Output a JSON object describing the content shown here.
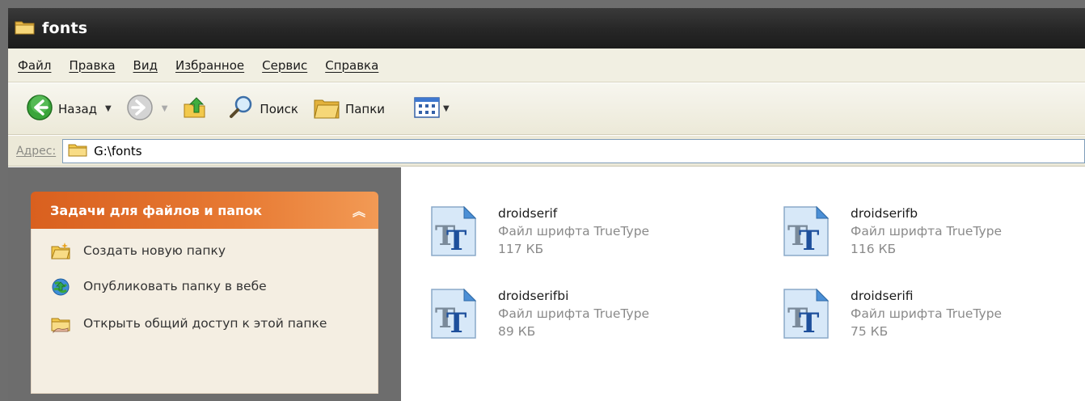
{
  "window": {
    "title": "fonts"
  },
  "menu": {
    "items": [
      "Файл",
      "Правка",
      "Вид",
      "Избранное",
      "Сервис",
      "Справка"
    ]
  },
  "toolbar": {
    "back_label": "Назад",
    "search_label": "Поиск",
    "folders_label": "Папки"
  },
  "address": {
    "label": "Адрес:",
    "value": "G:\\fonts"
  },
  "tasks": {
    "title": "Задачи для файлов и папок",
    "items": [
      {
        "label": "Создать новую папку",
        "icon": "new-folder-icon"
      },
      {
        "label": "Опубликовать папку в вебе",
        "icon": "publish-web-icon"
      },
      {
        "label": "Открыть общий доступ к этой папке",
        "icon": "share-folder-icon"
      }
    ]
  },
  "files": [
    {
      "name": "droidserif",
      "type": "Файл шрифта TrueType",
      "size": "117 КБ"
    },
    {
      "name": "droidserifb",
      "type": "Файл шрифта TrueType",
      "size": "116 КБ"
    },
    {
      "name": "droidserifbi",
      "type": "Файл шрифта TrueType",
      "size": "89 КБ"
    },
    {
      "name": "droidserifi",
      "type": "Файл шрифта TrueType",
      "size": "75 КБ"
    }
  ],
  "colors": {
    "task_header": "#e77a33",
    "titlebar": "#262626",
    "chrome": "#ece9d8"
  }
}
